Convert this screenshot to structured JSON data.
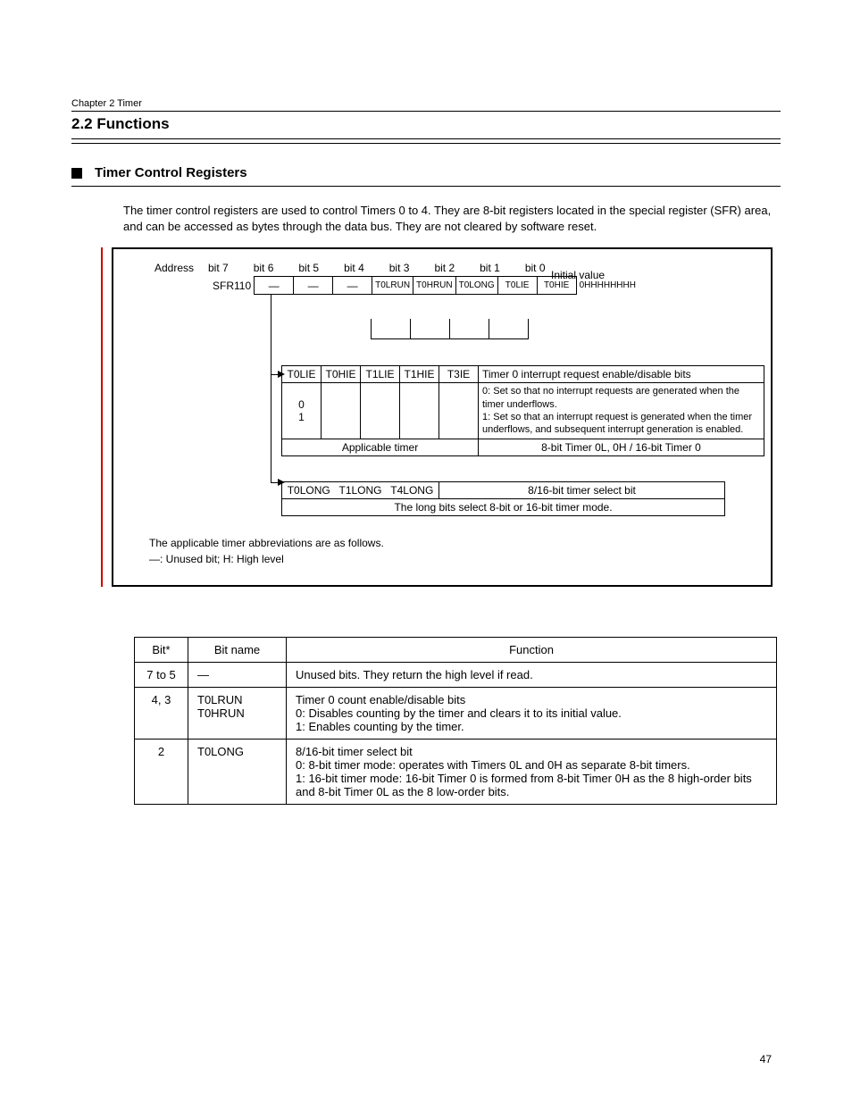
{
  "header": {
    "chapter": "Chapter 2   Timer",
    "section": "2.2  Functions"
  },
  "subhead": "Timer Control Registers",
  "intro": "The timer control registers are used to control Timers 0 to 4. They are 8-bit registers located in the special register (SFR) area, and can be accessed as bytes through the data bus. They are not cleared by software reset.",
  "diagram": {
    "address_label": "Address",
    "bit_headers": [
      "bit 7",
      "bit 6",
      "bit 5",
      "bit 4",
      "bit 3",
      "bit 2",
      "bit 1",
      "bit 0"
    ],
    "initval_label": "Initial value",
    "register_addr": "SFR110",
    "top_cells": [
      "—",
      "—",
      "—",
      "T0LRUN",
      "T0HRUN",
      "T0LONG",
      "T0LIE",
      "T0HIE"
    ],
    "initval": "0HHHHHHHH",
    "sel_label": "Timer 0 interrupt request enable/disable bits",
    "sel_rows": [
      "0: Set so that no interrupt requests are generated when the timer underflows.",
      "1: Set so that an interrupt request is generated when the timer underflows, and subsequent interrupt generation is enabled."
    ],
    "applicable_row_left": "Applicable timer",
    "applicable_row_right": "8-bit Timer 0L, 0H / 16-bit Timer 0",
    "sel2_label": "8/16-bit timer select bit",
    "sel2_row": "The long bits select 8-bit or 16-bit timer mode.",
    "legend1": "The applicable timer abbreviations are as follows.",
    "legend2": "—: Unused bit; H: High level"
  },
  "table": {
    "head_bit": "Bit*",
    "head_name": "Bit name",
    "head_func": "Function",
    "rows": [
      {
        "bit": "7 to 5",
        "name": "—",
        "func": "Unused bits. They return the high level if read."
      },
      {
        "bit": "4, 3",
        "name": "T0LRUN T0HRUN",
        "func": "Timer 0 count enable/disable bits\n0: Disables counting by the timer and clears it to its initial value.\n1: Enables counting by the timer."
      },
      {
        "bit": "2",
        "name": "T0LONG",
        "func": "8/16-bit timer select bit\n0: 8-bit timer mode: operates with Timers 0L and 0H as separate 8-bit timers.\n1: 16-bit timer mode: 16-bit Timer 0 is formed from 8-bit Timer 0H as the 8 high-order bits and 8-bit Timer 0L as the 8 low-order bits."
      }
    ]
  },
  "pagenum": "47"
}
